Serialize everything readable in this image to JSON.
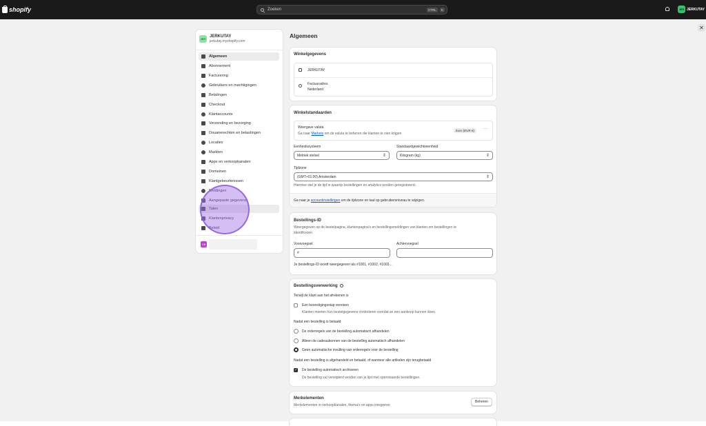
{
  "topbar": {
    "logo_text": "shopify",
    "search_placeholder": "Zoeken",
    "shortcut_key1": "CTRL",
    "shortcut_key2": "K",
    "store_initials": "JER",
    "store_name": "JERKUTAY"
  },
  "sidebar": {
    "store_initials": "JER",
    "store_name": "JERKUTAY",
    "store_domain": "jerkutay.myshopify.com",
    "items": [
      {
        "label": "Algemeen",
        "icon": "store-icon"
      },
      {
        "label": "Abonnement",
        "icon": "chart-icon"
      },
      {
        "label": "Facturering",
        "icon": "receipt-icon"
      },
      {
        "label": "Gebruikers en machtigingen",
        "icon": "users-icon"
      },
      {
        "label": "Betalingen",
        "icon": "payments-icon"
      },
      {
        "label": "Checkout",
        "icon": "cart-icon"
      },
      {
        "label": "Klantaccounts",
        "icon": "person-icon"
      },
      {
        "label": "Verzending en bezorging",
        "icon": "truck-icon"
      },
      {
        "label": "Douanerechten en belastingen",
        "icon": "tax-icon"
      },
      {
        "label": "Locaties",
        "icon": "location-icon"
      },
      {
        "label": "Markten",
        "icon": "globe-icon"
      },
      {
        "label": "Apps en verkoopkanalen",
        "icon": "apps-icon"
      },
      {
        "label": "Domeinen",
        "icon": "globe-icon"
      },
      {
        "label": "Klantgebeurtenissen",
        "icon": "events-icon"
      },
      {
        "label": "Meldingen",
        "icon": "bell-icon"
      },
      {
        "label": "Aangepaste gegevens",
        "icon": "data-icon"
      },
      {
        "label": "Talen",
        "icon": "language-icon"
      },
      {
        "label": "Klantenprivacy",
        "icon": "lock-icon"
      },
      {
        "label": "Beleid",
        "icon": "policy-icon"
      }
    ]
  },
  "page": {
    "title": "Algemeen"
  },
  "store_details": {
    "title": "Winkelgegevens",
    "store_name": "JERKUTAY",
    "billing_label": "Factuuradres",
    "billing_country": "Nederland"
  },
  "store_defaults": {
    "title": "Winkelstandaarden",
    "currency_label": "Weergave valuta",
    "currency_help_prefix": "Ga naar",
    "currency_help_link": "Markets",
    "currency_help_suffix": "om de valuta te beheren die klanten te zien krijgen",
    "currency_value": "Euro (EUR €)",
    "unit_system_label": "Eenheidssysteem",
    "unit_system_value": "Metriek stelsel",
    "weight_label": "Standaardgewichtseenheid",
    "weight_value": "Kilogram (kg)",
    "timezone_label": "Tijdzone",
    "timezone_value": "(GMT+01:00) Amsterdam",
    "timezone_help": "Hiermee stel je de tijd in waarop bestellingen en analytics worden geregistreerd.",
    "footer_prefix": "Ga naar je",
    "footer_link": "accountinstellingen",
    "footer_suffix": "om de tijdzone en taal op gebruikersniveau te wijzigen."
  },
  "order_id": {
    "title": "Bestellings-ID",
    "description_line1": "Weergegeven op de bestelpagina, klantenpagina's en bestellingsmeldingen van klanten om bestellingen te",
    "description_line2": "identificeren",
    "prefix_label": "Voorvoegsel",
    "prefix_value": "#",
    "suffix_label": "Achtervoegsel",
    "suffix_value": "",
    "example": "Je bestellings-ID wordt weergegeven als #1001, #1002, #1003..."
  },
  "order_processing": {
    "title": "Bestellingsverwerking",
    "checkout_heading": "Terwijl de klant aan het afrekenen is",
    "confirm_label": "Een bevestigingsstap vereisen",
    "confirm_help": "Klanten moeten hun bestelgegevens controleren voordat ze een aankoop kunnen doen.",
    "paid_heading": "Nadat een bestelling is betaald",
    "option1": "De orderregels van de bestelling automatisch afhandelen",
    "option2": "Alleen de cadeaubonnen van de bestelling automatisch afhandelen",
    "option3": "Geen automatische invulling van orderregels voor de bestelling",
    "fulfilled_heading": "Nadat een bestelling is afgehandeld en betaald, of wanneer alle artikelen zijn terugbetaald",
    "archive_label": "De bestelling automatisch archiveren",
    "archive_help": "De bestelling zal verwijderd worden van je lijst met openstaande bestellingen."
  },
  "brand": {
    "title": "Merkelementen",
    "description": "Merkelementen in verkoopkanalen, thema's en apps integreren",
    "button_label": "Beheren"
  },
  "colors": {
    "topbar": "#1a1a1a",
    "background": "#f1f1f1",
    "link": "#005bd3",
    "store_avatar": "#8be4a0",
    "cursor_highlight": "#a06ee6"
  }
}
